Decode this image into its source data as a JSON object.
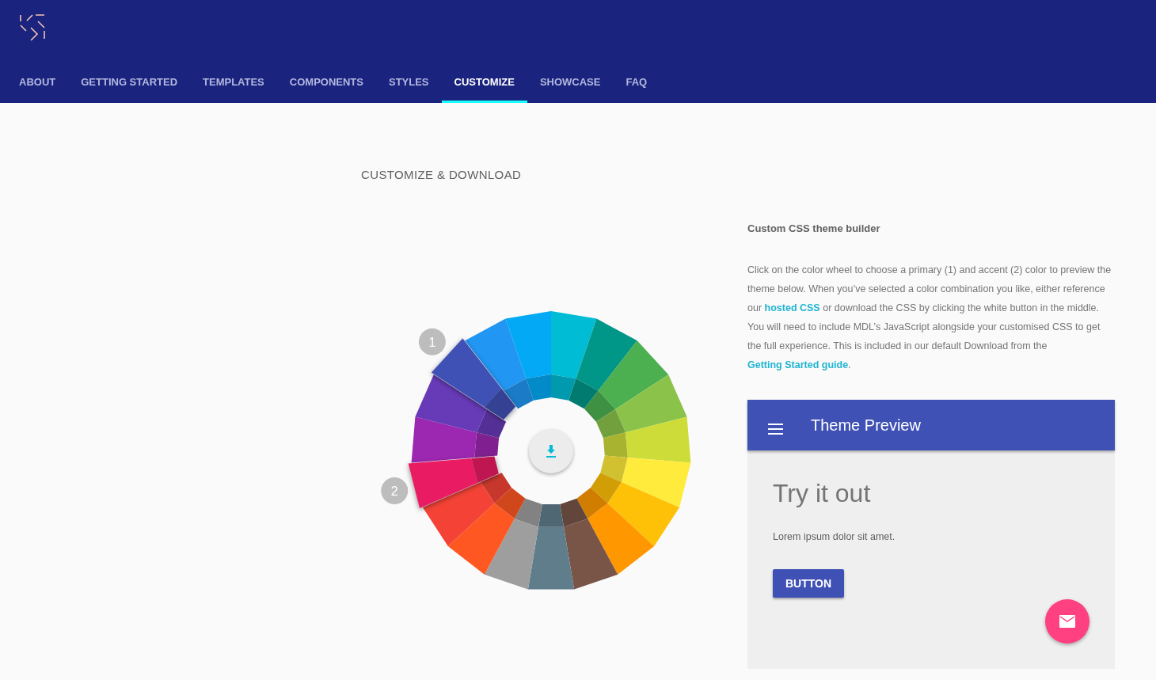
{
  "nav": [
    {
      "label": "ABOUT",
      "selected": false
    },
    {
      "label": "GETTING STARTED",
      "selected": false
    },
    {
      "label": "TEMPLATES",
      "selected": false
    },
    {
      "label": "COMPONENTS",
      "selected": false
    },
    {
      "label": "STYLES",
      "selected": false
    },
    {
      "label": "CUSTOMIZE",
      "selected": true
    },
    {
      "label": "SHOWCASE",
      "selected": false
    },
    {
      "label": "FAQ",
      "selected": false
    }
  ],
  "heading": "CUSTOMIZE & DOWNLOAD",
  "wheel": {
    "segments": [
      {
        "color": "#00bcd4",
        "selected": false
      },
      {
        "color": "#009688",
        "selected": false
      },
      {
        "color": "#4caf50",
        "selected": false
      },
      {
        "color": "#8bc34a",
        "selected": false
      },
      {
        "color": "#cddc39",
        "selected": false
      },
      {
        "color": "#ffeb3b",
        "selected": false
      },
      {
        "color": "#ffc107",
        "selected": false
      },
      {
        "color": "#ff9800",
        "selected": false
      },
      {
        "color": "#795548",
        "selected": false
      },
      {
        "color": "#607d8b",
        "selected": false
      },
      {
        "color": "#9e9e9e",
        "selected": false
      },
      {
        "color": "#ff5722",
        "selected": false
      },
      {
        "color": "#f44336",
        "selected": false
      },
      {
        "color": "#e91e63",
        "selected": true,
        "marker": "2"
      },
      {
        "color": "#9c27b0",
        "selected": false
      },
      {
        "color": "#673ab7",
        "selected": false
      },
      {
        "color": "#3f51b5",
        "selected": true,
        "marker": "1"
      },
      {
        "color": "#2196f3",
        "selected": false
      },
      {
        "color": "#03a9f4",
        "selected": false
      }
    ]
  },
  "builder": {
    "title": "Custom CSS theme builder",
    "parts": [
      {
        "kind": "text",
        "text": "Click on the color wheel to choose a primary (1) and accent (2) color to preview the theme below. When you’ve selected a color combination you like, either reference our "
      },
      {
        "kind": "link",
        "text": "hosted CSS"
      },
      {
        "kind": "text",
        "text": " or download the CSS by clicking the white button in the middle. You will need to include MDL’s JavaScript alongside your customised CSS to get the full experience. This is included in our default Download from the "
      },
      {
        "kind": "link",
        "text": "Getting Started guide"
      },
      {
        "kind": "text",
        "text": "."
      }
    ]
  },
  "preview": {
    "title": "Theme Preview",
    "headline": "Try it out",
    "body": "Lorem ipsum dolor sit amet.",
    "button": "BUTTON"
  }
}
